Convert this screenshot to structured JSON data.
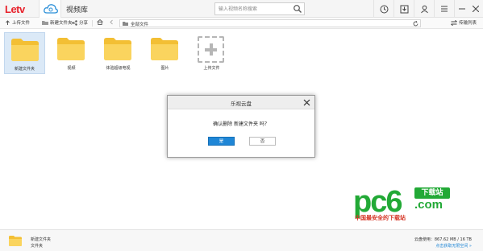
{
  "app": {
    "logo_text": "Letv",
    "library_tab": "视频库",
    "search_placeholder": "输入视频名称搜索"
  },
  "toolbar": {
    "upload": "上传文件",
    "new_folder": "新建文件夹",
    "share": "分享",
    "breadcrumb": "全部文件",
    "sort": "传输列表"
  },
  "files": [
    {
      "name": "新建文件夹"
    },
    {
      "name": "视频"
    },
    {
      "name": "体验超级电视"
    },
    {
      "name": "图片"
    }
  ],
  "upload_tile": {
    "label": "上传文件"
  },
  "dialog": {
    "title": "乐视云盘",
    "message": "确认删除 新建文件夹 吗？",
    "yes": "是",
    "no": "否"
  },
  "status": {
    "name": "新建文件夹",
    "type": "文件夹",
    "usage": "云盘使用：867.62 MB / 16 TB",
    "link": "点击获取无限空间 »"
  },
  "watermark": {
    "big": "pc6",
    "badge": "下载站",
    "com": ".com",
    "sub": "中国最安全的下载站"
  },
  "colors": {
    "brand_red": "#e8222c",
    "accent_blue": "#1f86d6",
    "folder_yellow": "#f8cd4c",
    "watermark_green": "#22a936"
  }
}
